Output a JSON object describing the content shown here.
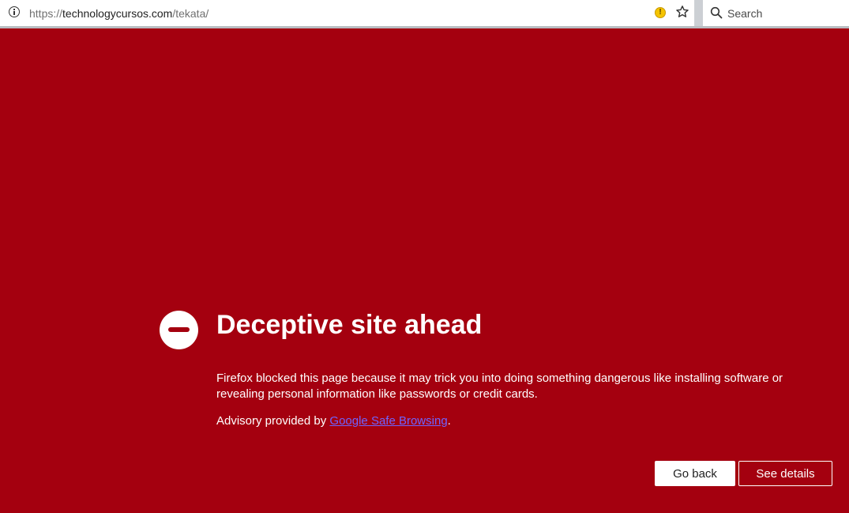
{
  "browser": {
    "url_scheme": "https://",
    "url_host": "technologycursos.com",
    "url_path": "/tekata/",
    "search_placeholder": "Search",
    "icons": [
      "info-icon",
      "warning-icon",
      "star-icon",
      "search-icon"
    ]
  },
  "warning": {
    "title": "Deceptive site ahead",
    "description": "Firefox blocked this page because it may trick you into doing something dangerous like installing software or revealing personal information like passwords or credit cards.",
    "advisory_prefix": "Advisory provided by ",
    "advisory_link": "Google Safe Browsing",
    "advisory_suffix": ".",
    "go_back_label": "Go back",
    "see_details_label": "See details",
    "background_color": "#a4000f",
    "icon": "block-icon"
  }
}
